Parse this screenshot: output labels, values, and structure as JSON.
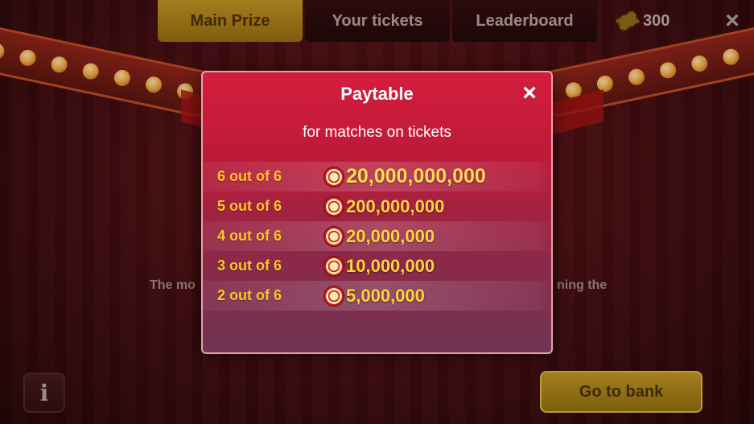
{
  "header": {
    "tabs": [
      {
        "label": "Main Prize",
        "active": true
      },
      {
        "label": "Your tickets",
        "active": false
      },
      {
        "label": "Leaderboard",
        "active": false
      }
    ],
    "ticket_count": "300",
    "ticket_icon": "ticket-icon",
    "close_icon": "×"
  },
  "background": {
    "desc_left": "The mo",
    "desc_right": "ning the"
  },
  "footer": {
    "info_label": "i",
    "bank_button": "Go to bank"
  },
  "modal": {
    "title": "Paytable",
    "close": "×",
    "subtitle": "for matches on tickets",
    "rows": [
      {
        "match": "6 out of 6",
        "amount": "20,000,000,000"
      },
      {
        "match": "5 out of 6",
        "amount": "200,000,000"
      },
      {
        "match": "4 out of 6",
        "amount": "20,000,000"
      },
      {
        "match": "3 out of 6",
        "amount": "10,000,000"
      },
      {
        "match": "2 out of 6",
        "amount": "5,000,000"
      }
    ]
  },
  "colors": {
    "modal_top": "#d51d3c",
    "modal_bottom": "#6e3452",
    "gold_text": "#ffc526",
    "tab_active": "#a67e1e"
  }
}
